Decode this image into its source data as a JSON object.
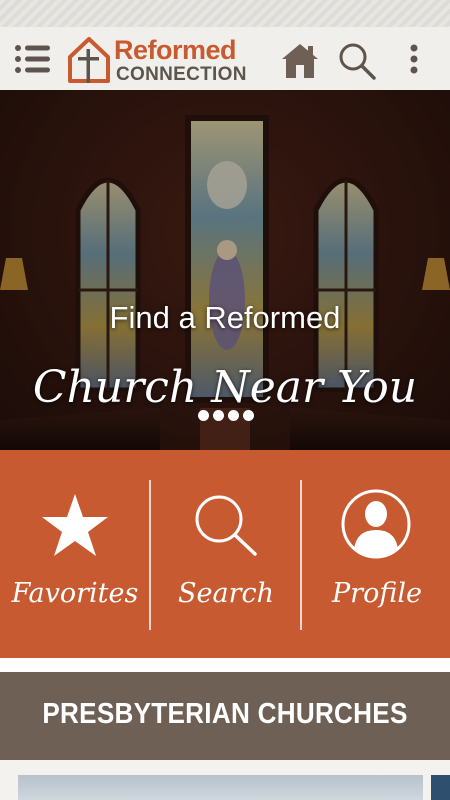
{
  "app": {
    "logo_word1": "Reformed",
    "logo_word2": "CONNECTION",
    "brand_colors": {
      "orange": "#c85a31",
      "brown": "#6e6054",
      "dark_text": "#5d544d"
    }
  },
  "toolbar": {
    "menu_icon": "hamburger-menu-icon",
    "home_icon": "home-icon",
    "search_icon": "search-icon",
    "more_icon": "more-vertical-icon"
  },
  "hero": {
    "line1": "Find a Reformed",
    "line2": "Church Near You",
    "carousel_dots": 4
  },
  "actions": [
    {
      "label": "Favorites",
      "icon": "star-icon"
    },
    {
      "label": "Search",
      "icon": "search-icon"
    },
    {
      "label": "Profile",
      "icon": "profile-icon"
    }
  ],
  "section": {
    "title": "PRESBYTERIAN CHURCHES"
  }
}
